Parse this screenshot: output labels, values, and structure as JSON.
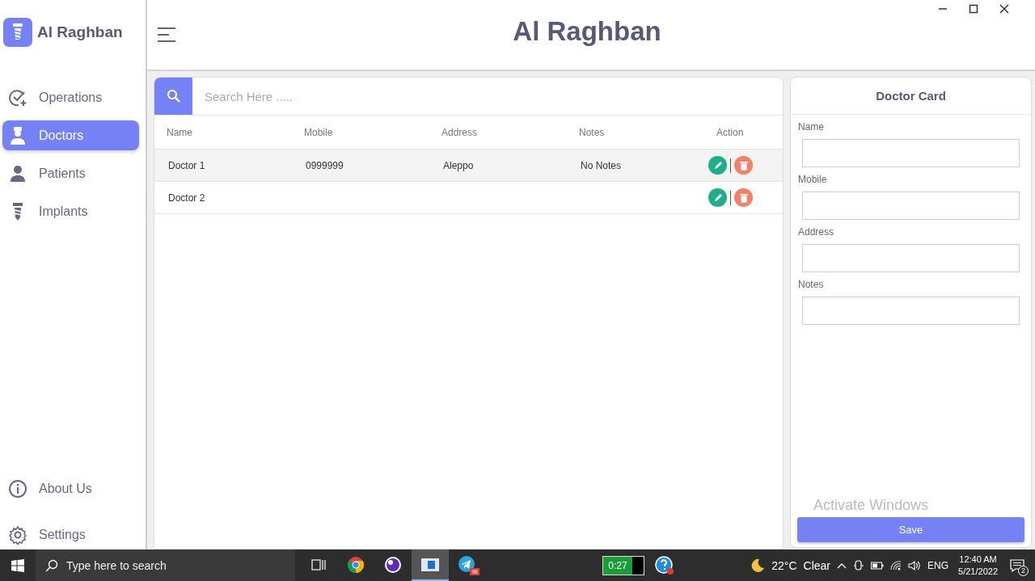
{
  "app": {
    "logo_text": "Al Raghban"
  },
  "sidebar": {
    "items": [
      {
        "label": "Operations",
        "kind": "operations",
        "selected": false
      },
      {
        "label": "Doctors",
        "kind": "doctors",
        "selected": true
      },
      {
        "label": "Patients",
        "kind": "patients",
        "selected": false
      },
      {
        "label": "Implants",
        "kind": "implants",
        "selected": false
      }
    ],
    "bottom_items": [
      {
        "label": "About Us",
        "kind": "about",
        "selected": false
      },
      {
        "label": "Settings",
        "kind": "settings",
        "selected": false
      }
    ]
  },
  "header": {
    "title": "Al Raghban"
  },
  "search": {
    "placeholder": "Search Here ....."
  },
  "table": {
    "columns": [
      "Name",
      "Mobile",
      "Address",
      "Notes",
      "Action"
    ],
    "rows": [
      {
        "name": "Doctor 1",
        "mobile": "0999999",
        "address": "Aleppo",
        "notes": "No Notes",
        "selected": true
      },
      {
        "name": "Doctor 2",
        "selected": false
      }
    ]
  },
  "card": {
    "title": "Doctor Card",
    "fields": [
      {
        "label": "Name"
      },
      {
        "label": "Mobile"
      },
      {
        "label": "Address"
      },
      {
        "label": "Notes"
      }
    ],
    "button": "Save"
  },
  "overlay": {
    "text": "Activate Windows"
  },
  "taskbar": {
    "search_placeholder": "Type here to search",
    "apps": [
      {
        "kind": "taskview",
        "active": false
      },
      {
        "kind": "chrome",
        "active": false
      },
      {
        "kind": "circle",
        "active": false
      },
      {
        "kind": "window",
        "active": true
      },
      {
        "kind": "telegram",
        "active": false,
        "badge": "98"
      }
    ],
    "battery_time": "0:27",
    "temperature": "22°C",
    "weather": "Clear",
    "language": "ENG",
    "time": "12:40 AM",
    "date": "5/21/2022",
    "notifications": "2"
  }
}
